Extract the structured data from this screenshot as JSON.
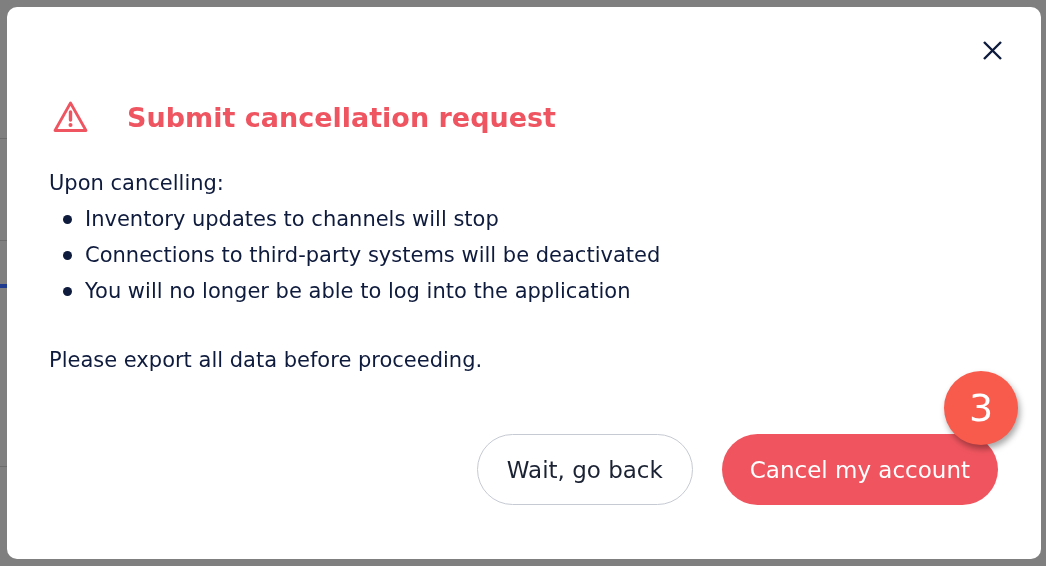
{
  "dialog": {
    "title": "Submit cancellation request",
    "intro": "Upon cancelling:",
    "consequences": [
      "Inventory updates to channels will stop",
      "Connections to third-party systems will be deactivated",
      "You will no longer be able to log into the application"
    ],
    "note": "Please export all data before proceeding.",
    "buttons": [
      {
        "label": "Wait, go back",
        "kind": "secondary"
      },
      {
        "label": "Cancel my account",
        "kind": "primary",
        "badge": "3"
      }
    ]
  }
}
